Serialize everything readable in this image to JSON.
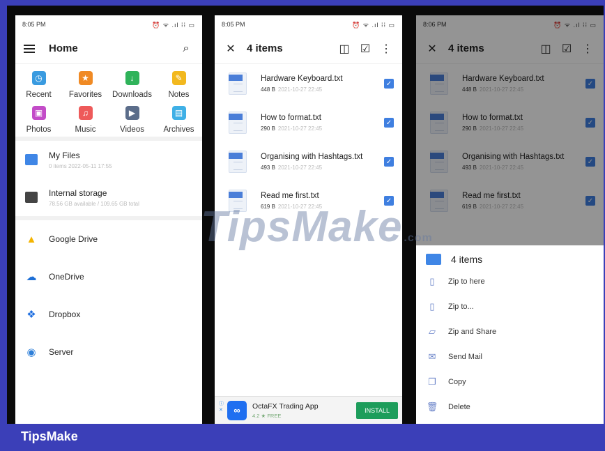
{
  "screen1": {
    "status": {
      "time": "8:05 PM",
      "icons": "⏰ ᯤ .ıl ⁞⁞ ▭"
    },
    "title": "Home",
    "categories": [
      {
        "label": "Recent",
        "icon": "recent-icon",
        "color": "#3a9be0",
        "glyph": "◷"
      },
      {
        "label": "Favorites",
        "icon": "star-icon",
        "color": "#f08a24",
        "glyph": "★"
      },
      {
        "label": "Downloads",
        "icon": "download-icon",
        "color": "#2fb35a",
        "glyph": "↓"
      },
      {
        "label": "Notes",
        "icon": "pencil-icon",
        "color": "#f2b81e",
        "glyph": "✎"
      },
      {
        "label": "Photos",
        "icon": "photo-icon",
        "color": "#c34cc8",
        "glyph": "▣"
      },
      {
        "label": "Music",
        "icon": "music-icon",
        "color": "#ee5a5a",
        "glyph": "♫"
      },
      {
        "label": "Videos",
        "icon": "video-icon",
        "color": "#5b6d8a",
        "glyph": "▶"
      },
      {
        "label": "Archives",
        "icon": "archive-icon",
        "color": "#3fb0e6",
        "glyph": "▤"
      }
    ],
    "storage": [
      {
        "name": "My Files",
        "detail": "0 items 2022-05-11 17:55",
        "color": "#3f86e6",
        "icon": "folder-icon"
      },
      {
        "name": "Internal storage",
        "detail": "78.56 GB available / 109.65 GB total",
        "color": "#444444",
        "icon": "phone-storage-icon"
      }
    ],
    "clouds": [
      {
        "name": "Google Drive",
        "glyph": "▲",
        "color": "#f4b400",
        "icon": "google-drive-icon"
      },
      {
        "name": "OneDrive",
        "glyph": "☁",
        "color": "#1e6fd6",
        "icon": "onedrive-icon"
      },
      {
        "name": "Dropbox",
        "glyph": "❖",
        "color": "#1f6fe0",
        "icon": "dropbox-icon"
      },
      {
        "name": "Server",
        "glyph": "◉",
        "color": "#2e7fd8",
        "icon": "server-icon"
      }
    ]
  },
  "screen2": {
    "status": {
      "time": "8:05 PM",
      "icons": "⏰ ᯤ .ıl ⁞⁞ ▭"
    },
    "title": "4 items",
    "files": [
      {
        "name": "Hardware Keyboard.txt",
        "size": "448 B",
        "date": "2021-10-27 22:45"
      },
      {
        "name": "How to format.txt",
        "size": "290 B",
        "date": "2021-10-27 22:45"
      },
      {
        "name": "Organising with Hashtags.txt",
        "size": "493 B",
        "date": "2021-10-27 22:45"
      },
      {
        "name": "Read me first.txt",
        "size": "619 B",
        "date": "2021-10-27 22:45"
      }
    ],
    "ad": {
      "title": "OctaFX Trading App",
      "rating": "4.2 ★ FREE",
      "button": "INSTALL"
    }
  },
  "screen3": {
    "status": {
      "time": "8:06 PM",
      "icons": "⏰ ᯤ .ıl ⁞⁞ ▭"
    },
    "title": "4 items",
    "sheet_title": "4 items",
    "actions": [
      {
        "label": "Zip to here",
        "icon": "zip-icon",
        "glyph": "▯"
      },
      {
        "label": "Zip to...",
        "icon": "zip-to-icon",
        "glyph": "▯"
      },
      {
        "label": "Zip and Share",
        "icon": "zip-share-icon",
        "glyph": "▱"
      },
      {
        "label": "Send Mail",
        "icon": "mail-icon",
        "glyph": "✉"
      },
      {
        "label": "Copy",
        "icon": "copy-icon",
        "glyph": "❐"
      },
      {
        "label": "Delete",
        "icon": "trash-icon",
        "glyph": "🗑"
      }
    ]
  },
  "watermark": {
    "main": "TipsMake",
    "suffix": ".com"
  },
  "brand": "TipsMake"
}
